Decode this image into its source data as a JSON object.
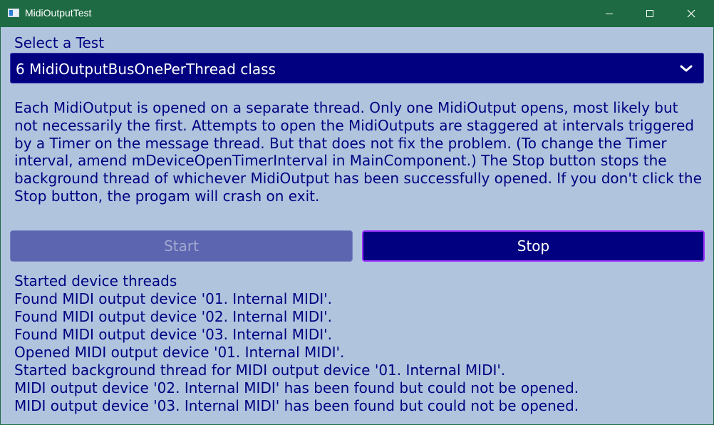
{
  "window": {
    "title": "MidiOutputTest",
    "colors": {
      "titlebar": "#1e6b43",
      "client_background": "#b0c4de",
      "text": "#000080",
      "combo_background": "#000080",
      "stop_background": "#000080",
      "stop_border": "#9b30ff",
      "start_background_disabled": "#5c66b0"
    },
    "controls": {
      "minimize_icon": "minimize-icon",
      "maximize_icon": "maximize-icon",
      "close_icon": "close-icon"
    }
  },
  "test_selector": {
    "label": "Select a Test",
    "selected": "6 MidiOutputBusOnePerThread class",
    "icon": "chevron-down-icon"
  },
  "description": "Each MidiOutput is opened on a separate thread. Only one MidiOutput opens, most likely but not necessarily the first. Attempts to open the MidiOutputs are staggered at intervals triggered by a Timer on the message thread. But that does not fix the problem. (To change the Timer interval, amend mDeviceOpenTimerInterval in MainComponent.) The Stop button stops the background thread of whichever MidiOutput has been successfully opened. If you don't click the Stop button, the progam will crash on exit.",
  "buttons": {
    "start": "Start",
    "start_enabled": false,
    "stop": "Stop"
  },
  "log": [
    "Started device threads",
    "Found MIDI output device '01. Internal MIDI'.",
    "Found MIDI output device '02. Internal MIDI'.",
    "Found MIDI output device '03. Internal MIDI'.",
    "Opened MIDI output device '01. Internal MIDI'.",
    "Started background thread for MIDI output device '01. Internal MIDI'.",
    "MIDI output device '02. Internal MIDI' has been found but could not be opened.",
    "MIDI output device '03. Internal MIDI' has been found but could not be opened."
  ]
}
